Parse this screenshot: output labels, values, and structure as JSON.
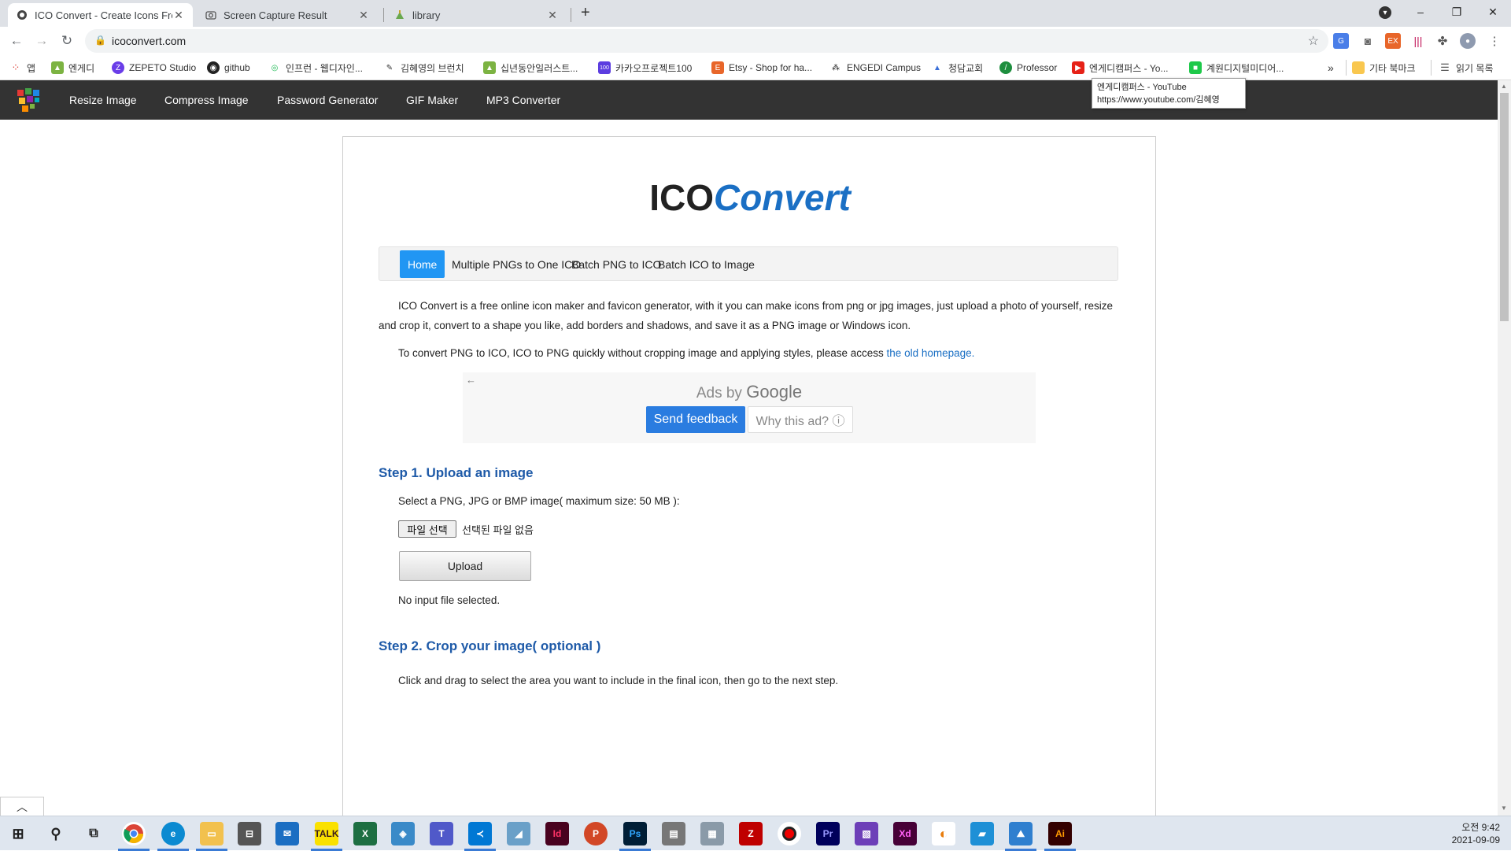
{
  "browser": {
    "tabs": [
      {
        "title": "ICO Convert - Create Icons From",
        "icon": "ico-convert-favicon",
        "active": true
      },
      {
        "title": "Screen Capture Result",
        "icon": "camera-icon",
        "active": false
      },
      {
        "title": "library",
        "icon": "library-favicon",
        "active": false
      }
    ],
    "new_tab": "+",
    "url": "icoconvert.com",
    "window_controls": {
      "minimize": "–",
      "restore": "❐",
      "close": "✕"
    }
  },
  "bookmarks": {
    "items": [
      {
        "label": "앱",
        "icon": "apps-grid-icon"
      },
      {
        "label": "엔게디",
        "icon": "engedi-icon"
      },
      {
        "label": "ZEPETO Studio",
        "icon": "zepeto-icon"
      },
      {
        "label": "github",
        "icon": "github-icon"
      },
      {
        "label": "인프런 - 웹디자인...",
        "icon": "inflearn-icon"
      },
      {
        "label": "김혜영의 브런치",
        "icon": "brunch-icon"
      },
      {
        "label": "십년동안일러스트...",
        "icon": "engedi-icon"
      },
      {
        "label": "카카오프로젝트100",
        "icon": "kakao100-icon"
      },
      {
        "label": "Etsy - Shop for ha...",
        "icon": "etsy-icon"
      },
      {
        "label": "ENGEDI Campus",
        "icon": "engedi-campus-icon"
      },
      {
        "label": "청담교회",
        "icon": "church-icon"
      },
      {
        "label": "Professor",
        "icon": "professor-icon"
      },
      {
        "label": "엔게디캠퍼스 - Yo...",
        "icon": "youtube-icon"
      },
      {
        "label": "계원디지털미디어...",
        "icon": "kaywon-icon"
      }
    ],
    "more": "»",
    "other_folder": "기타 북마크",
    "reading_list": "읽기 목록"
  },
  "tooltip": {
    "line1": "엔게디캠퍼스 - YouTube",
    "line2": "https://www.youtube.com/김혜영"
  },
  "site_nav": {
    "items": [
      "Resize Image",
      "Compress Image",
      "Password Generator",
      "GIF Maker",
      "MP3 Converter"
    ]
  },
  "brand": {
    "part1": "ICO",
    "part2": "Convert"
  },
  "subnav": {
    "items": [
      "Home",
      "Multiple PNGs to One ICO",
      "Batch PNG to ICO",
      "Batch ICO to Image"
    ],
    "active_index": 0
  },
  "intro": {
    "p1": "ICO Convert is a free online icon maker and favicon generator, with it you can make icons from png or jpg images, just upload a photo of yourself, resize and crop it, convert to a shape you like, add borders and shadows, and save it as a PNG image or Windows icon.",
    "p2_text": "To convert PNG to ICO, ICO to PNG quickly without cropping image and applying styles, please access ",
    "p2_link": "the old homepage."
  },
  "ad": {
    "back": "←",
    "ads_by": "Ads by",
    "google": "Google",
    "feedback": "Send feedback",
    "why": "Why this ad? ⓘ"
  },
  "step1": {
    "title": "Step 1. Upload an image",
    "instruction": "Select a PNG, JPG or BMP image( maximum size: 50 MB ):",
    "file_button": "파일 선택",
    "no_file": "선택된 파일 없음",
    "upload_button": "Upload",
    "status": "No input file selected."
  },
  "step2": {
    "title": "Step 2. Crop your image( optional )",
    "instruction": "Click and drag to select the area you want to include in the final icon, then go to the next step."
  },
  "taskbar": {
    "apps": [
      "Chrome",
      "Edge",
      "File Explorer",
      "Store",
      "Mail",
      "KakaoTalk",
      "Excel",
      "Outlook",
      "Teams",
      "VS Code",
      "App",
      "InDesign",
      "PowerPoint",
      "Photoshop",
      "App",
      "Calculator",
      "FileZilla",
      "Recorder",
      "Premiere",
      "App",
      "XD",
      "Blender",
      "App",
      "Photos",
      "Illustrator"
    ],
    "time": "오전 9:42",
    "date": "2021-09-09"
  },
  "colors": {
    "site_nav_bg": "#333333",
    "accent_blue": "#2196f3",
    "step_heading": "#1e5aa8",
    "brand_blue": "#1a6fc4"
  }
}
